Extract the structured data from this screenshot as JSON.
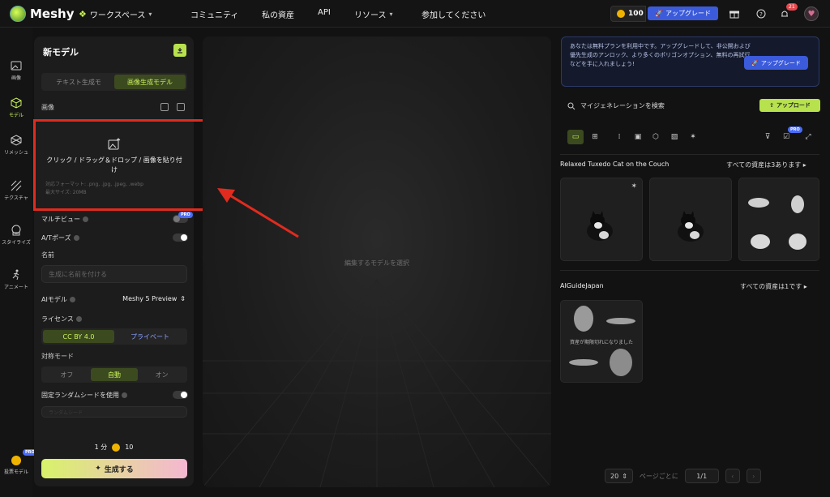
{
  "app": {
    "name": "Meshy"
  },
  "topnav": {
    "workspace": "ワークスペース",
    "community": "コミュニティ",
    "assets": "私の資産",
    "api": "API",
    "resources": "リソース",
    "join": "参加してください",
    "credits": "100",
    "upgrade": "アップグレード",
    "notifications": "21"
  },
  "rail": [
    {
      "icon": "image-icon",
      "label": "画像"
    },
    {
      "icon": "cube-icon",
      "label": "モデル"
    },
    {
      "icon": "remesh-icon",
      "label": "リメッシュ"
    },
    {
      "icon": "texture-icon",
      "label": "テクスチャ"
    },
    {
      "icon": "stylize-icon",
      "label": "スタイライズ"
    },
    {
      "icon": "animate-icon",
      "label": "アニメート"
    },
    {
      "icon": "vote-icon",
      "label": "投票モデル",
      "badge": "PRO"
    }
  ],
  "panel": {
    "title": "新モデル",
    "tabs": [
      "テキスト生成モ",
      "画像生成モデル"
    ],
    "image_label": "画像",
    "upload_main": "クリック / ドラッグ＆ドロップ / 画像を貼り付け",
    "upload_formats": "対応フォーマット: .png, .jpg, .jpeg, .webp",
    "upload_max": "最大サイズ: 20MB",
    "multiview": "マルチビュー",
    "multiview_badge": "PRO",
    "apose": "A/Tポーズ",
    "name_label": "名前",
    "name_placeholder": "生成に名前を付ける",
    "ai_model_label": "AIモデル",
    "ai_model_value": "Meshy 5 Preview",
    "license_label": "ライセンス",
    "license_options": [
      "CC BY 4.0",
      "プライベート"
    ],
    "symmetry_label": "対称モード",
    "symmetry_options": [
      "オフ",
      "自動",
      "オン"
    ],
    "seed_label": "固定ランダムシードを使用",
    "seed_placeholder": "ランダムシード",
    "time": "1 分",
    "cost": "10",
    "generate": "生成する"
  },
  "viewport": {
    "hint": "編集するモデルを選択"
  },
  "right": {
    "notice": "あなたは無料プランを利用中です。アップグレードして、非公開および優先生成のアンロック、より多くのポリゴンオプション、無料の再試行などを手に入れましょう!",
    "notice_btn": "アップグレード",
    "search": "マイジェネレーションを検索",
    "upload": "アップロード",
    "toolbar_badge": "PRO",
    "section1_title": "Relaxed Tuxedo Cat on the Couch",
    "section1_link": "すべての資産は3あります",
    "section2_title": "AIGuideJapan",
    "section2_link": "すべての資産は1です",
    "expired_caption": "資産が期限切れになりました",
    "per_page": "20",
    "per_page_label": "ページごとに",
    "page": "1/1"
  },
  "colors": {
    "accent": "#c9f25a",
    "upgrade": "#3b5bdb",
    "highlight": "#e02b1e"
  }
}
